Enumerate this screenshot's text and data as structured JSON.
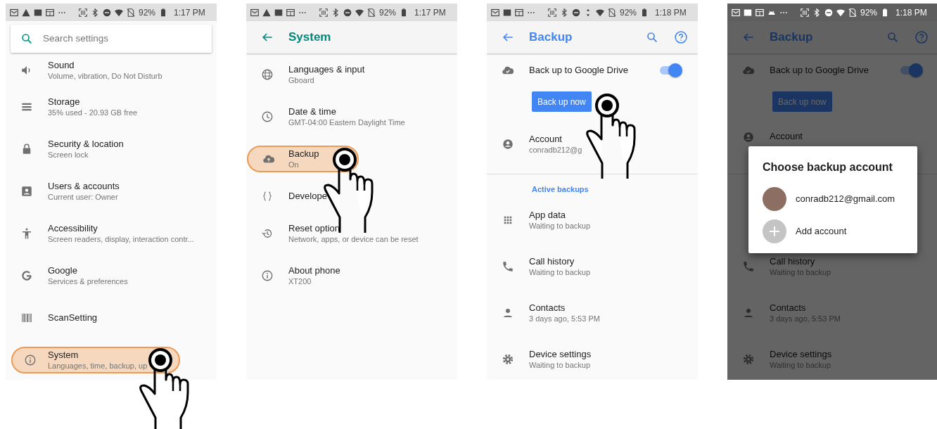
{
  "screens": [
    {
      "kind": "settings_home",
      "dimmed": false,
      "status_bar": {
        "battery": "92%",
        "time": "1:17 PM"
      },
      "search": {
        "placeholder": "Search settings"
      },
      "items": [
        {
          "title": "Sound",
          "subtitle": "Volume, vibration, Do Not Disturb",
          "selected": false
        },
        {
          "title": "Storage",
          "subtitle": "35% used - 20.93 GB free",
          "selected": false
        },
        {
          "title": "Security & location",
          "subtitle": "Screen lock",
          "selected": false
        },
        {
          "title": "Users & accounts",
          "subtitle": "Current user: Owner",
          "selected": false
        },
        {
          "title": "Accessibility",
          "subtitle": "Screen readers, display, interaction contr...",
          "selected": false
        },
        {
          "title": "Google",
          "subtitle": "Services & preferences",
          "selected": false
        },
        {
          "title": "ScanSetting",
          "selected": false
        },
        {
          "title": "System",
          "subtitle": "Languages, time, backup, up",
          "selected": true
        }
      ]
    },
    {
      "kind": "list_page",
      "dimmed": false,
      "status_bar": {
        "battery": "92%",
        "time": "1:17 PM"
      },
      "title": "System",
      "items": [
        {
          "title": "Languages & input",
          "subtitle": "Gboard",
          "selected": false
        },
        {
          "title": "Date & time",
          "subtitle": "GMT-04:00 Eastern Daylight Time",
          "selected": false
        },
        {
          "title": "Backup",
          "subtitle": "On",
          "selected": true
        },
        {
          "title": "Develope",
          "selected": false
        },
        {
          "title": "Reset option",
          "subtitle": "Network, apps, or device can be reset",
          "selected": false
        },
        {
          "title": "About phone",
          "subtitle": "XT200",
          "selected": false
        }
      ]
    },
    {
      "kind": "backup",
      "dimmed": false,
      "status_bar": {
        "battery": "92%",
        "time": "1:18 PM"
      },
      "title": "Backup",
      "toggle": {
        "label": "Back up to Google Drive",
        "on": true
      },
      "button": "Back up now",
      "account": {
        "title": "Account",
        "subtitle": "conradb212@g"
      },
      "section_label": "Active backups",
      "items": [
        {
          "title": "App data",
          "subtitle": "Waiting to backup"
        },
        {
          "title": "Call history",
          "subtitle": "Waiting to backup"
        },
        {
          "title": "Contacts",
          "subtitle": "3 days ago, 5:53 PM"
        },
        {
          "title": "Device settings",
          "subtitle": "Waiting to backup"
        }
      ]
    },
    {
      "kind": "backup",
      "dimmed": true,
      "status_bar": {
        "battery": "92%",
        "time": "1:18 PM"
      },
      "title": "Backup",
      "toggle": {
        "label": "Back up to Google Drive",
        "on": true
      },
      "button": "Back up now",
      "account": {
        "title": "Account"
      },
      "items": [
        {
          "title": "Call history",
          "subtitle": "Waiting to backup"
        },
        {
          "title": "Contacts",
          "subtitle": "3 days ago, 5:53 PM"
        },
        {
          "title": "Device settings",
          "subtitle": "Waiting to backup"
        }
      ],
      "dialog": {
        "title": "Choose backup account",
        "options": [
          {
            "kind": "account",
            "label": "conradb212@gmail.com"
          },
          {
            "kind": "add",
            "label": "Add account"
          }
        ]
      }
    }
  ]
}
